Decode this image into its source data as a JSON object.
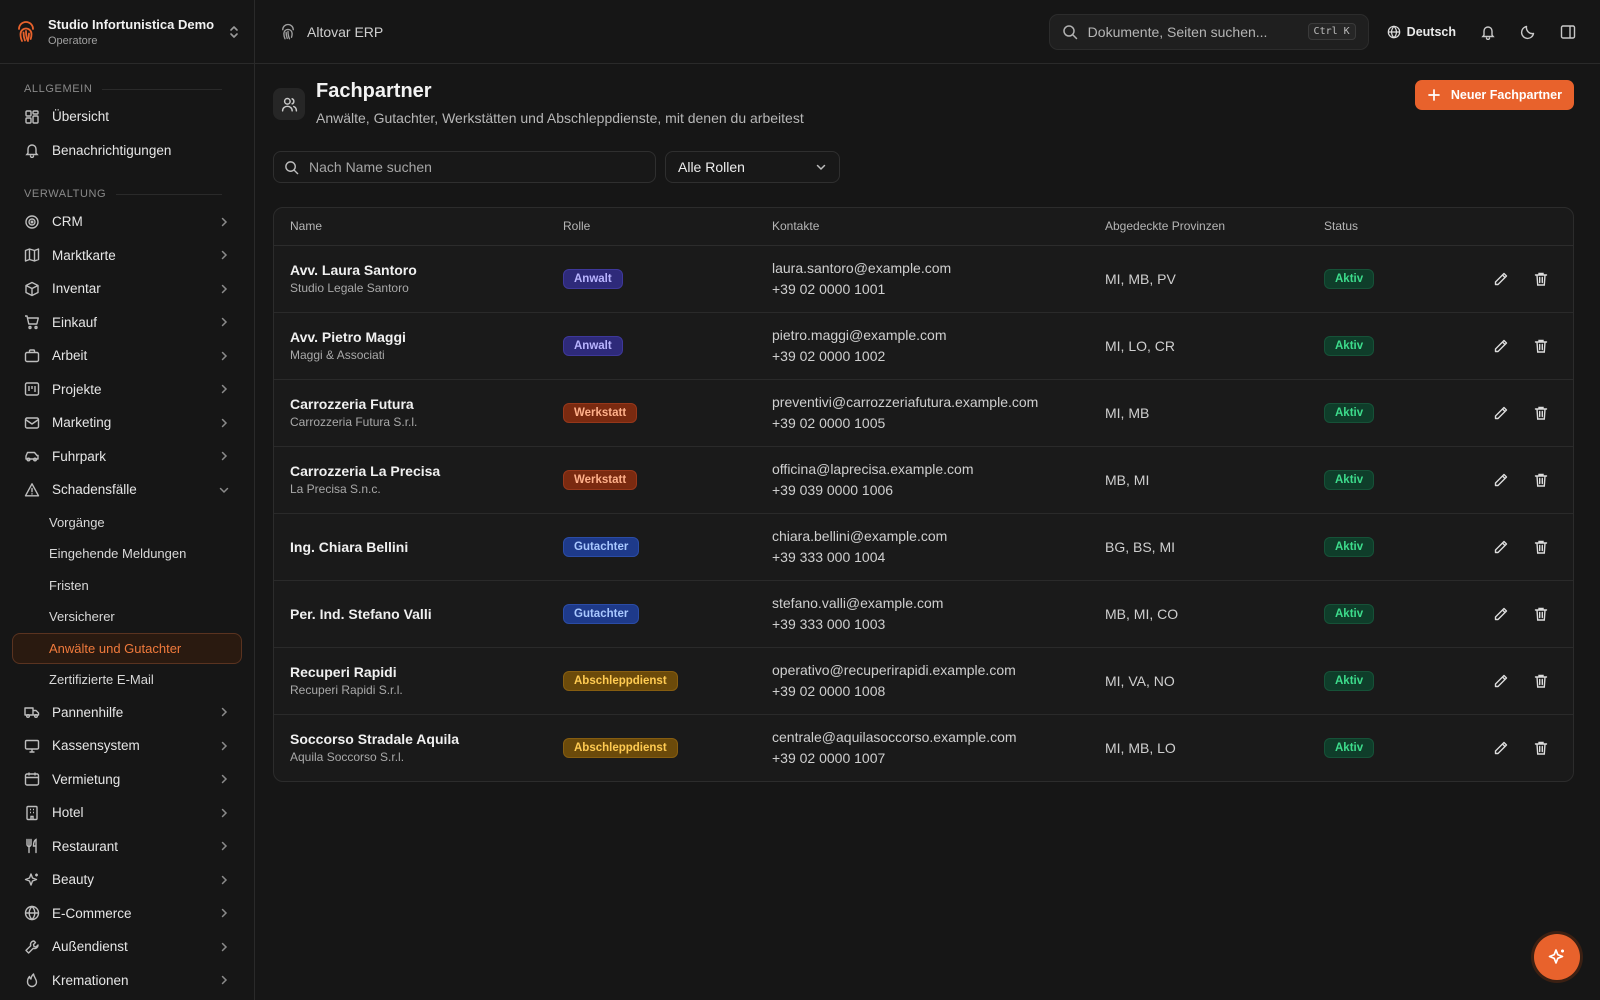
{
  "workspace": {
    "name": "Studio Infortunistica Demo",
    "role": "Operatore"
  },
  "app": {
    "name": "Altovar ERP"
  },
  "search": {
    "placeholder": "Dokumente, Seiten suchen...",
    "shortcut": "Ctrl K"
  },
  "language": "Deutsch",
  "sidebar": {
    "group_general": "ALLGEMEIN",
    "general_items": [
      {
        "label": "Übersicht",
        "icon": "dashboard-icon"
      },
      {
        "label": "Benachrichtigungen",
        "icon": "bell-icon"
      }
    ],
    "group_admin": "VERWALTUNG",
    "admin_items_top": [
      {
        "label": "CRM",
        "icon": "target-icon"
      },
      {
        "label": "Marktkarte",
        "icon": "map-icon"
      },
      {
        "label": "Inventar",
        "icon": "box-icon"
      },
      {
        "label": "Einkauf",
        "icon": "cart-icon"
      },
      {
        "label": "Arbeit",
        "icon": "briefcase-icon"
      },
      {
        "label": "Projekte",
        "icon": "kanban-icon"
      },
      {
        "label": "Marketing",
        "icon": "mail-icon"
      },
      {
        "label": "Fuhrpark",
        "icon": "car-icon"
      }
    ],
    "expanded": {
      "label": "Schadensfälle",
      "icon": "warning-icon"
    },
    "sub_items": [
      "Vorgänge",
      "Eingehende Meldungen",
      "Fristen",
      "Versicherer",
      "Anwälte und Gutachter",
      "Zertifizierte E-Mail"
    ],
    "active_sub": "Anwälte und Gutachter",
    "admin_items_bottom": [
      {
        "label": "Pannenhilfe",
        "icon": "truck-icon"
      },
      {
        "label": "Kassensystem",
        "icon": "monitor-icon"
      },
      {
        "label": "Vermietung",
        "icon": "calendar-icon"
      },
      {
        "label": "Hotel",
        "icon": "building-icon"
      },
      {
        "label": "Restaurant",
        "icon": "cutlery-icon"
      },
      {
        "label": "Beauty",
        "icon": "sparkle-icon"
      },
      {
        "label": "E-Commerce",
        "icon": "globe-icon"
      },
      {
        "label": "Außendienst",
        "icon": "wrench-icon"
      },
      {
        "label": "Kremationen",
        "icon": "flame-icon"
      }
    ]
  },
  "page": {
    "title": "Fachpartner",
    "subtitle": "Anwälte, Gutachter, Werkstätten und Abschleppdienste, mit denen du arbeitest",
    "new_button": "Neuer Fachpartner"
  },
  "filters": {
    "search_placeholder": "Nach Name suchen",
    "role_value": "Alle Rollen"
  },
  "table": {
    "columns": [
      "Name",
      "Rolle",
      "Kontakte",
      "Abgedeckte Provinzen",
      "Status"
    ],
    "rows": [
      {
        "name": "Avv. Laura Santoro",
        "org": "Studio Legale Santoro",
        "role": "Anwalt",
        "role_kind": "anwalt",
        "email": "laura.santoro@example.com",
        "phone": "+39 02 0000 1001",
        "provinces": "MI, MB, PV",
        "status": "Aktiv"
      },
      {
        "name": "Avv. Pietro Maggi",
        "org": "Maggi & Associati",
        "role": "Anwalt",
        "role_kind": "anwalt",
        "email": "pietro.maggi@example.com",
        "phone": "+39 02 0000 1002",
        "provinces": "MI, LO, CR",
        "status": "Aktiv"
      },
      {
        "name": "Carrozzeria Futura",
        "org": "Carrozzeria Futura S.r.l.",
        "role": "Werkstatt",
        "role_kind": "werk",
        "email": "preventivi@carrozzeriafutura.example.com",
        "phone": "+39 02 0000 1005",
        "provinces": "MI, MB",
        "status": "Aktiv"
      },
      {
        "name": "Carrozzeria La Precisa",
        "org": "La Precisa S.n.c.",
        "role": "Werkstatt",
        "role_kind": "werk",
        "email": "officina@laprecisa.example.com",
        "phone": "+39 039 0000 1006",
        "provinces": "MB, MI",
        "status": "Aktiv"
      },
      {
        "name": "Ing. Chiara Bellini",
        "org": "",
        "role": "Gutachter",
        "role_kind": "gut",
        "email": "chiara.bellini@example.com",
        "phone": "+39 333 000 1004",
        "provinces": "BG, BS, MI",
        "status": "Aktiv"
      },
      {
        "name": "Per. Ind. Stefano Valli",
        "org": "",
        "role": "Gutachter",
        "role_kind": "gut",
        "email": "stefano.valli@example.com",
        "phone": "+39 333 000 1003",
        "provinces": "MB, MI, CO",
        "status": "Aktiv"
      },
      {
        "name": "Recuperi Rapidi",
        "org": "Recuperi Rapidi S.r.l.",
        "role": "Abschleppdienst",
        "role_kind": "abs",
        "email": "operativo@recuperirapidi.example.com",
        "phone": "+39 02 0000 1008",
        "provinces": "MI, VA, NO",
        "status": "Aktiv"
      },
      {
        "name": "Soccorso Stradale Aquila",
        "org": "Aquila Soccorso S.r.l.",
        "role": "Abschleppdienst",
        "role_kind": "abs",
        "email": "centrale@aquilasoccorso.example.com",
        "phone": "+39 02 0000 1007",
        "provinces": "MI, MB, LO",
        "status": "Aktiv"
      }
    ]
  },
  "colors": {
    "accent": "#e8622c",
    "background": "#161616",
    "active_status": "#3ddc8c"
  }
}
